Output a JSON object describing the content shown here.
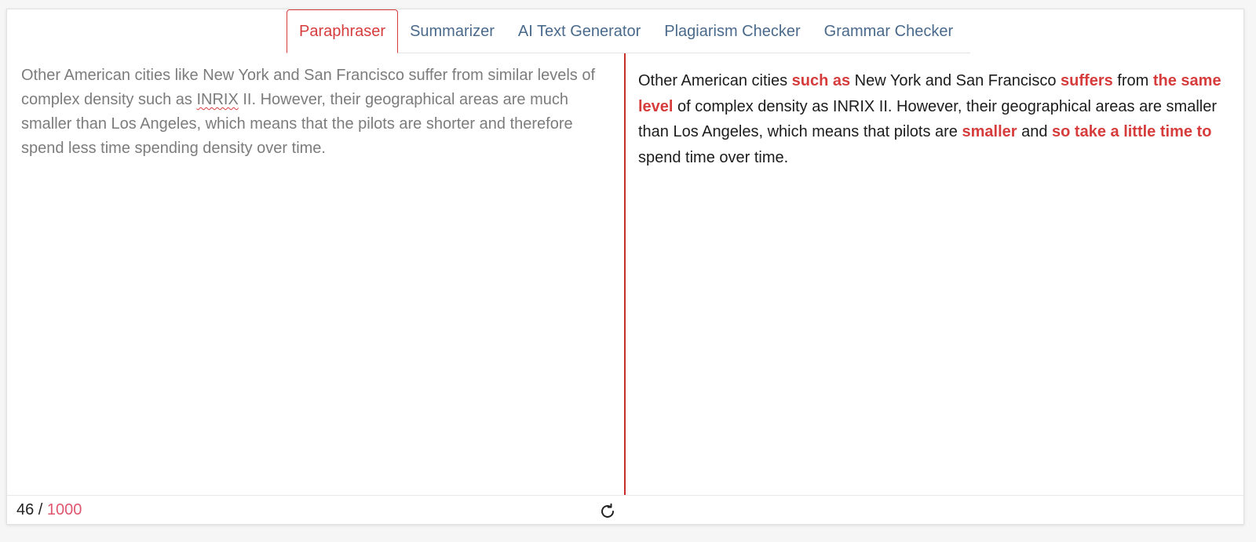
{
  "colors": {
    "accent": "#d63c3c",
    "tab_text": "#4a6a8c",
    "counter_max": "#e0566f"
  },
  "tabs": [
    {
      "label": "Paraphraser",
      "active": true
    },
    {
      "label": "Summarizer",
      "active": false
    },
    {
      "label": "AI Text Generator",
      "active": false
    },
    {
      "label": "Plagiarism Checker",
      "active": false
    },
    {
      "label": "Grammar Checker",
      "active": false
    }
  ],
  "input": {
    "text_before": "Other American cities like New York and San Francisco suffer from similar levels of complex density such as ",
    "misspelled_word": "INRIX",
    "text_after": " II. However, their geographical areas are much smaller than Los Angeles, which means that the pilots are shorter and therefore spend less time spending density over time."
  },
  "output": {
    "segments": [
      {
        "text": "Other American cities ",
        "changed": false
      },
      {
        "text": "such as",
        "changed": true
      },
      {
        "text": " New York and San Francisco ",
        "changed": false
      },
      {
        "text": "suffers",
        "changed": true
      },
      {
        "text": " from ",
        "changed": false
      },
      {
        "text": "the same level",
        "changed": true
      },
      {
        "text": " of complex density as INRIX II. However, their geographical areas are smaller than Los Angeles, which means that pilots are ",
        "changed": false
      },
      {
        "text": "smaller",
        "changed": true
      },
      {
        "text": " and ",
        "changed": false
      },
      {
        "text": "so take a little time to",
        "changed": true
      },
      {
        "text": " spend time over time.",
        "changed": false
      }
    ]
  },
  "footer": {
    "word_count": "46",
    "separator": " / ",
    "word_limit": "1000",
    "refresh_icon": "refresh-icon"
  }
}
